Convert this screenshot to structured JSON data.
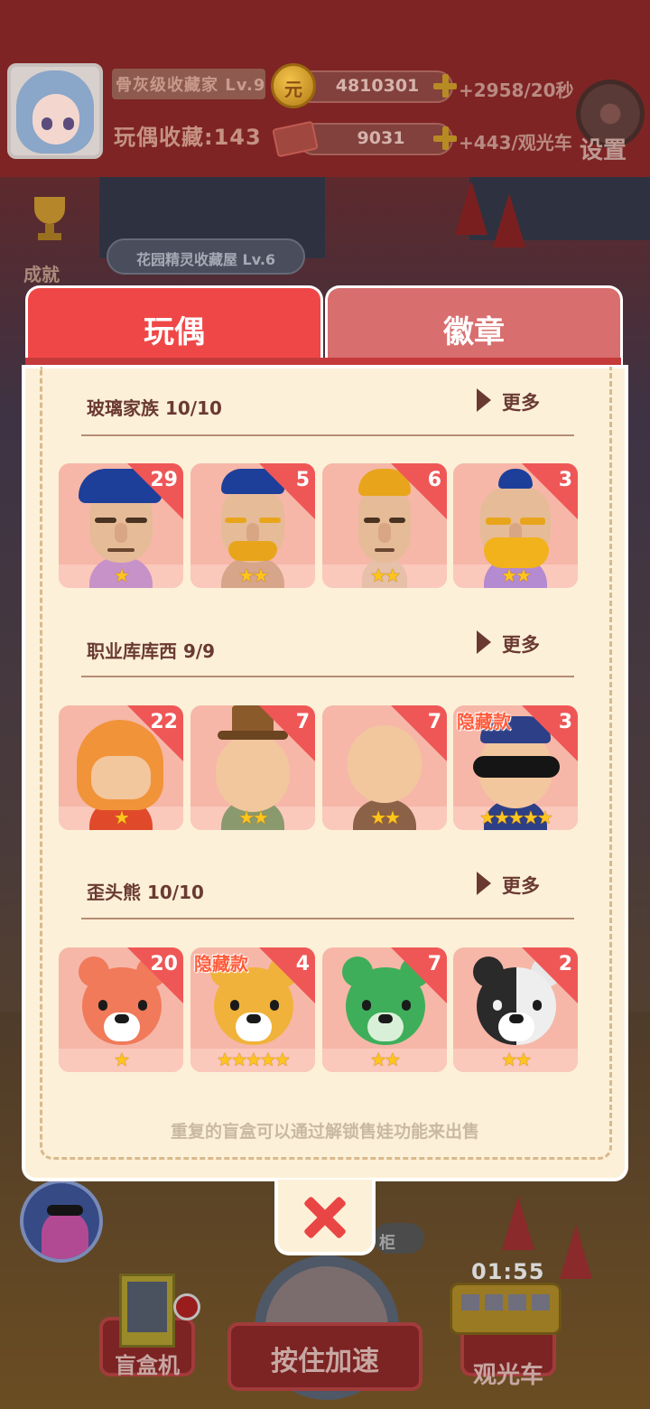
{
  "hud": {
    "player_rank": "骨灰级收藏家 Lv.9",
    "collection_count": "玩偶收藏:143",
    "coins": "4810301",
    "coin_rate": "+2958/20秒",
    "coin_icon": "元",
    "tickets": "9031",
    "ticket_rate": "+443/观光车",
    "settings_label": "设置",
    "achievement_label": "成就",
    "house_label": "花园精灵收藏屋 Lv.6"
  },
  "tabs": [
    {
      "label": "玩偶",
      "active": true
    },
    {
      "label": "徽章",
      "active": false
    }
  ],
  "more_label": "更多",
  "sections": [
    {
      "title": "玻璃家族 10/10",
      "cards": [
        {
          "count": "29",
          "stars": "★",
          "hidden": ""
        },
        {
          "count": "5",
          "stars": "★★",
          "hidden": ""
        },
        {
          "count": "6",
          "stars": "★★",
          "hidden": ""
        },
        {
          "count": "3",
          "stars": "★★",
          "hidden": ""
        }
      ]
    },
    {
      "title": "职业库库西 9/9",
      "cards": [
        {
          "count": "22",
          "stars": "★",
          "hidden": ""
        },
        {
          "count": "7",
          "stars": "★★",
          "hidden": ""
        },
        {
          "count": "7",
          "stars": "★★",
          "hidden": ""
        },
        {
          "count": "3",
          "stars": "★★★★★",
          "hidden": "隐藏款"
        }
      ]
    },
    {
      "title": "歪头熊 10/10",
      "cards": [
        {
          "count": "20",
          "stars": "★",
          "hidden": ""
        },
        {
          "count": "4",
          "stars": "★★★★★",
          "hidden": "隐藏款"
        },
        {
          "count": "7",
          "stars": "★★",
          "hidden": ""
        },
        {
          "count": "2",
          "stars": "★★",
          "hidden": ""
        }
      ]
    }
  ],
  "footer_note": "重复的盲盒可以通过解锁售娃功能来出售",
  "bottom": {
    "cabinet_label": "柜",
    "timer": "01:55",
    "blindbox_label": "盲盒机",
    "hold_label": "按住加速",
    "tram_label": "观光车"
  },
  "icons": {
    "close": "close-icon",
    "more": "play-arrow-icon",
    "settings": "gear-icon",
    "achievement": "trophy-icon",
    "coin": "coin-icon",
    "ticket": "ticket-icon"
  },
  "colors": {
    "active_tab": "#ef4747",
    "inactive_tab": "#d86e6e",
    "panel_bg": "#fcf0d8",
    "card_bg": "#f6b7a8",
    "count_corner": "#ef5757",
    "star": "#ffc51f",
    "close_x": "#ea4545"
  }
}
